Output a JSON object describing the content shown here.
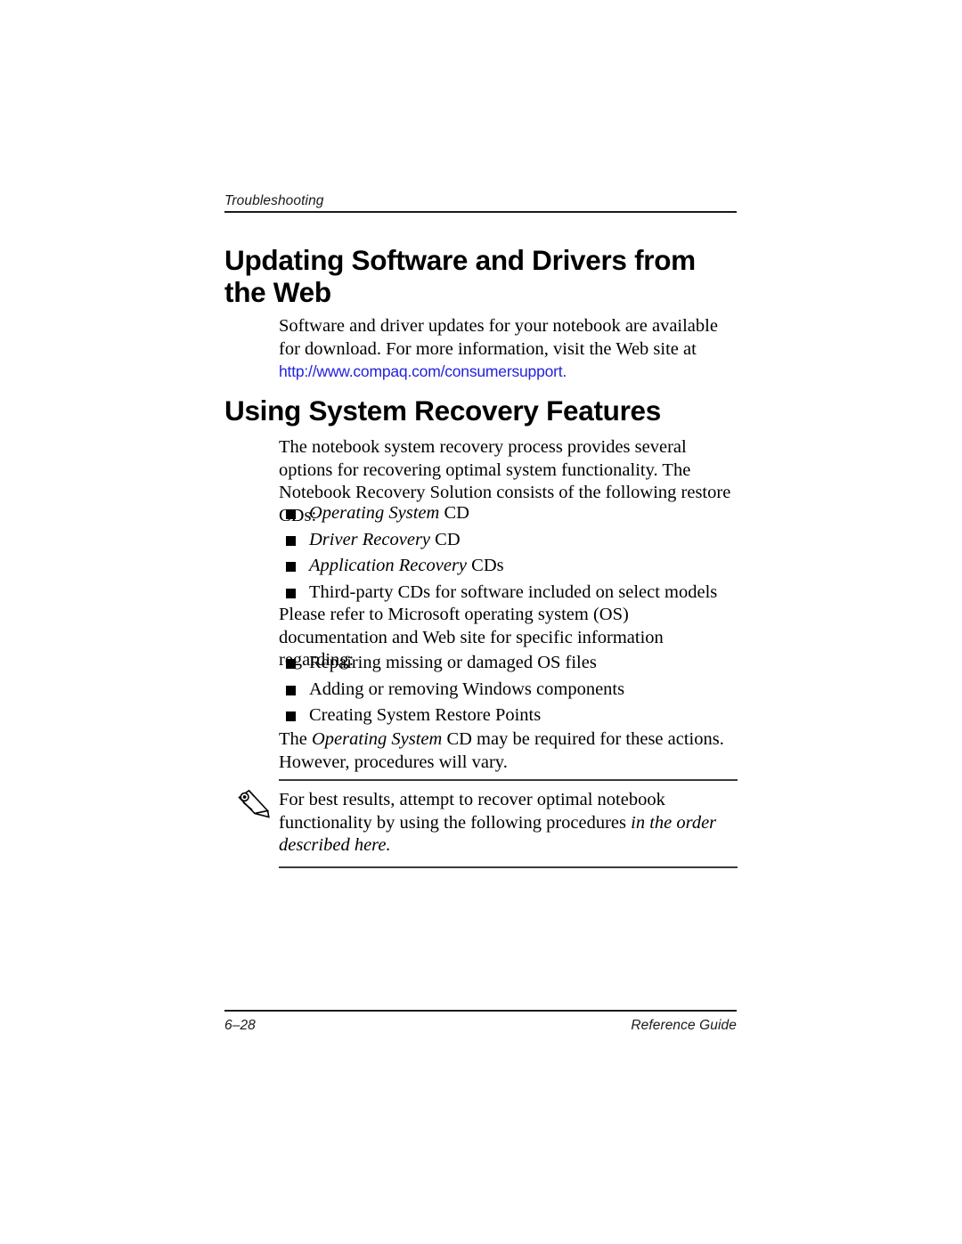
{
  "header": {
    "running_head": "Troubleshooting"
  },
  "sections": [
    {
      "heading": "Updating Software and Drivers from the Web",
      "paragraph_lead": "Software and driver updates for your notebook are available for download. For more information, visit the Web site at ",
      "url": "http://www.compaq.com/consumersupport."
    },
    {
      "heading": "Using System Recovery Features",
      "paragraph_intro": "The notebook system recovery process provides several options for recovering optimal system functionality. The Notebook Recovery Solution consists of the following restore CDs:",
      "cd_list": [
        {
          "italic": "Operating System",
          "roman": " CD"
        },
        {
          "italic": "Driver Recovery",
          "roman": " CD"
        },
        {
          "italic": "Application Recovery",
          "roman": " CDs"
        },
        {
          "italic": "",
          "roman": "Third-party CDs for software included on select models"
        }
      ],
      "paragraph_refer": "Please refer to Microsoft operating system (OS) documentation and Web site for specific information regarding:",
      "os_list": [
        "Repairing missing or damaged OS files",
        "Adding or removing Windows components",
        "Creating System Restore Points"
      ],
      "paragraph_oscd_pre": "The ",
      "paragraph_oscd_italic": "Operating System",
      "paragraph_oscd_post": " CD may be required for these actions. However, procedures will vary."
    }
  ],
  "note": {
    "icon": "pencil-icon",
    "text_roman": "For best results, attempt to recover optimal notebook functionality by using the following procedures ",
    "text_italic": "in the order described here."
  },
  "footer": {
    "page_number": "6–28",
    "guide_title": "Reference Guide"
  },
  "colors": {
    "link": "#2222dd",
    "rule": "#1a1a1a",
    "text": "#000000",
    "page_background": "#ffffff"
  }
}
